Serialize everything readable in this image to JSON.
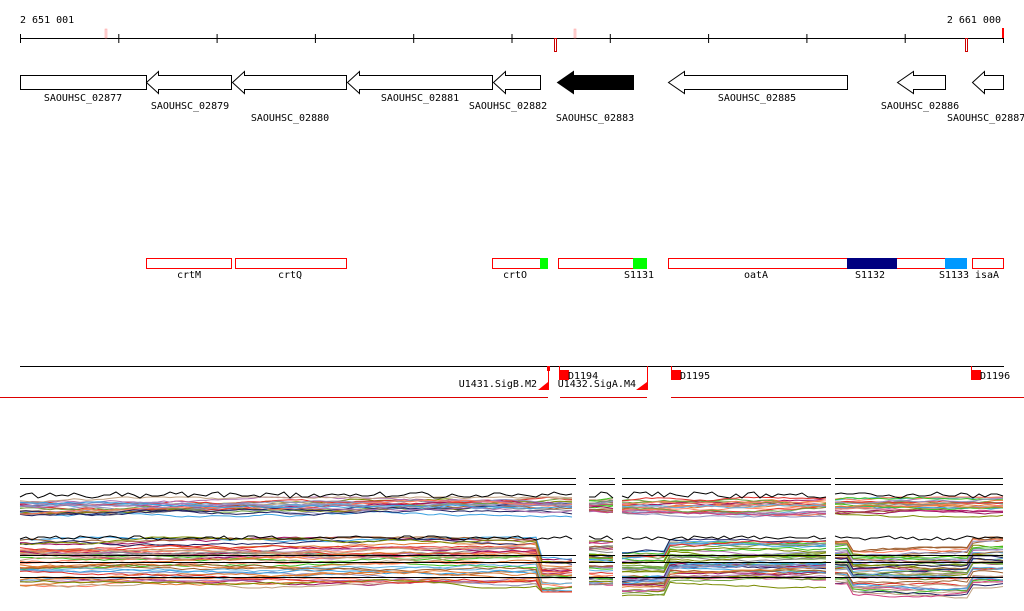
{
  "ruler": {
    "start_label": "2 651 001",
    "end_label": "2 661 000"
  },
  "genes": [
    {
      "label": "SAOUHSC_02877",
      "strand": "+",
      "selected": false
    },
    {
      "label": "SAOUHSC_02879",
      "strand": "-",
      "selected": false
    },
    {
      "label": "SAOUHSC_02880",
      "strand": "-",
      "selected": false
    },
    {
      "label": "SAOUHSC_02881",
      "strand": "-",
      "selected": false
    },
    {
      "label": "SAOUHSC_02882",
      "strand": "-",
      "selected": false
    },
    {
      "label": "SAOUHSC_02883",
      "strand": "-",
      "selected": true
    },
    {
      "label": "SAOUHSC_02885",
      "strand": "-",
      "selected": false
    },
    {
      "label": "SAOUHSC_02886",
      "strand": "-",
      "selected": false
    },
    {
      "label": "SAOUHSC_02887",
      "strand": "-",
      "selected": false
    }
  ],
  "features": [
    {
      "label": "crtM"
    },
    {
      "label": "crtQ"
    },
    {
      "label": "crtO"
    },
    {
      "label": "S1131"
    },
    {
      "label": "oatA"
    },
    {
      "label": "S1132"
    },
    {
      "label": "S1133"
    },
    {
      "label": "isaA"
    }
  ],
  "regulatory": [
    {
      "label": "U1431.SigB.M2",
      "type": "promoter"
    },
    {
      "label": "D1194",
      "type": "terminator"
    },
    {
      "label": "U1432.SigA.M4",
      "type": "promoter"
    },
    {
      "label": "D1195",
      "type": "terminator"
    },
    {
      "label": "D1196",
      "type": "terminator"
    }
  ],
  "colors": {
    "feature_outline": "#ff0000",
    "green": "#00ff00",
    "navy": "#000080",
    "sky": "#0099ff",
    "series": [
      "#e0302a",
      "#7a8a00",
      "#b070b0",
      "#3aa0e0",
      "#e07a30",
      "#a01060",
      "#40c020",
      "#888888",
      "#c0a080",
      "#202060",
      "#d04080",
      "#60b0e0",
      "#a06030",
      "#9090c0",
      "#ff8060",
      "#70a040"
    ]
  }
}
